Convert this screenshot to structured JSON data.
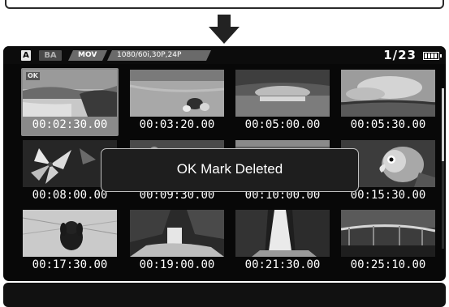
{
  "status": {
    "badge_a": "A",
    "badge_ba": "BA",
    "format": "MOV",
    "frame_rate": "1080/60i,30P,24P",
    "counter": "1/23"
  },
  "dialog": {
    "message": "OK Mark Deleted"
  },
  "clips": [
    {
      "timecode": "00:02:30.00",
      "thumbnail": "beach-islands",
      "ok_mark": "OK",
      "selected": true
    },
    {
      "timecode": "00:03:20.00",
      "thumbnail": "beach-stones"
    },
    {
      "timecode": "00:05:00.00",
      "thumbnail": "sunset-sea"
    },
    {
      "timecode": "00:05:30.00",
      "thumbnail": "cloud-sky"
    },
    {
      "timecode": "00:08:00.00",
      "thumbnail": "lily-flower"
    },
    {
      "timecode": "00:09:30.00",
      "thumbnail": "flowers"
    },
    {
      "timecode": "00:10:00.00",
      "thumbnail": "landscape"
    },
    {
      "timecode": "00:15:30.00",
      "thumbnail": "parrot"
    },
    {
      "timecode": "00:17:30.00",
      "thumbnail": "dog-grass"
    },
    {
      "timecode": "00:19:00.00",
      "thumbnail": "small-waterfall"
    },
    {
      "timecode": "00:21:30.00",
      "thumbnail": "tall-waterfall"
    },
    {
      "timecode": "00:25:10.00",
      "thumbnail": "bridge"
    }
  ],
  "colors": {
    "screen_bg": "#080808",
    "selection": "#8a8a8a",
    "dialog_bg": "#1e1e1e",
    "dialog_border": "#bfbfbf"
  }
}
